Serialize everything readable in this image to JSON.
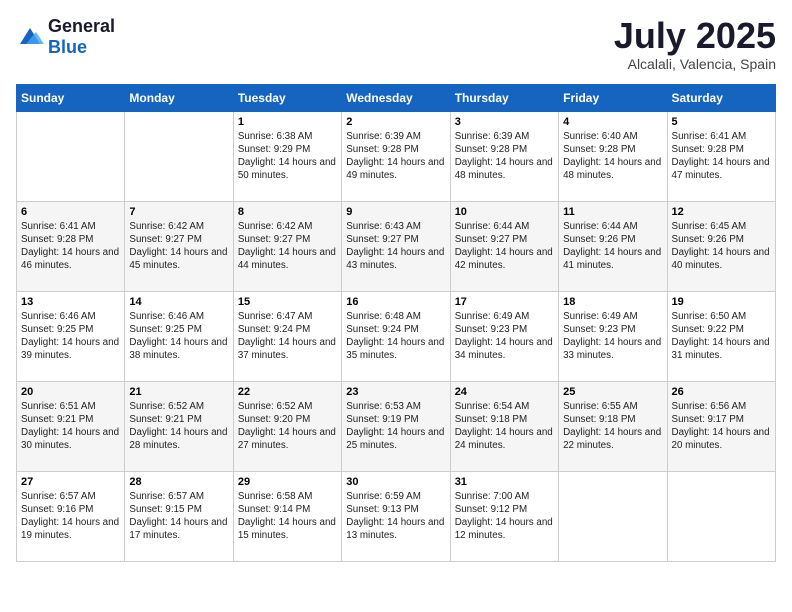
{
  "logo": {
    "general": "General",
    "blue": "Blue"
  },
  "title": "July 2025",
  "location": "Alcalali, Valencia, Spain",
  "days_of_week": [
    "Sunday",
    "Monday",
    "Tuesday",
    "Wednesday",
    "Thursday",
    "Friday",
    "Saturday"
  ],
  "weeks": [
    [
      {
        "day": "",
        "info": ""
      },
      {
        "day": "",
        "info": ""
      },
      {
        "day": "1",
        "info": "Sunrise: 6:38 AM\nSunset: 9:29 PM\nDaylight: 14 hours and 50 minutes."
      },
      {
        "day": "2",
        "info": "Sunrise: 6:39 AM\nSunset: 9:28 PM\nDaylight: 14 hours and 49 minutes."
      },
      {
        "day": "3",
        "info": "Sunrise: 6:39 AM\nSunset: 9:28 PM\nDaylight: 14 hours and 48 minutes."
      },
      {
        "day": "4",
        "info": "Sunrise: 6:40 AM\nSunset: 9:28 PM\nDaylight: 14 hours and 48 minutes."
      },
      {
        "day": "5",
        "info": "Sunrise: 6:41 AM\nSunset: 9:28 PM\nDaylight: 14 hours and 47 minutes."
      }
    ],
    [
      {
        "day": "6",
        "info": "Sunrise: 6:41 AM\nSunset: 9:28 PM\nDaylight: 14 hours and 46 minutes."
      },
      {
        "day": "7",
        "info": "Sunrise: 6:42 AM\nSunset: 9:27 PM\nDaylight: 14 hours and 45 minutes."
      },
      {
        "day": "8",
        "info": "Sunrise: 6:42 AM\nSunset: 9:27 PM\nDaylight: 14 hours and 44 minutes."
      },
      {
        "day": "9",
        "info": "Sunrise: 6:43 AM\nSunset: 9:27 PM\nDaylight: 14 hours and 43 minutes."
      },
      {
        "day": "10",
        "info": "Sunrise: 6:44 AM\nSunset: 9:27 PM\nDaylight: 14 hours and 42 minutes."
      },
      {
        "day": "11",
        "info": "Sunrise: 6:44 AM\nSunset: 9:26 PM\nDaylight: 14 hours and 41 minutes."
      },
      {
        "day": "12",
        "info": "Sunrise: 6:45 AM\nSunset: 9:26 PM\nDaylight: 14 hours and 40 minutes."
      }
    ],
    [
      {
        "day": "13",
        "info": "Sunrise: 6:46 AM\nSunset: 9:25 PM\nDaylight: 14 hours and 39 minutes."
      },
      {
        "day": "14",
        "info": "Sunrise: 6:46 AM\nSunset: 9:25 PM\nDaylight: 14 hours and 38 minutes."
      },
      {
        "day": "15",
        "info": "Sunrise: 6:47 AM\nSunset: 9:24 PM\nDaylight: 14 hours and 37 minutes."
      },
      {
        "day": "16",
        "info": "Sunrise: 6:48 AM\nSunset: 9:24 PM\nDaylight: 14 hours and 35 minutes."
      },
      {
        "day": "17",
        "info": "Sunrise: 6:49 AM\nSunset: 9:23 PM\nDaylight: 14 hours and 34 minutes."
      },
      {
        "day": "18",
        "info": "Sunrise: 6:49 AM\nSunset: 9:23 PM\nDaylight: 14 hours and 33 minutes."
      },
      {
        "day": "19",
        "info": "Sunrise: 6:50 AM\nSunset: 9:22 PM\nDaylight: 14 hours and 31 minutes."
      }
    ],
    [
      {
        "day": "20",
        "info": "Sunrise: 6:51 AM\nSunset: 9:21 PM\nDaylight: 14 hours and 30 minutes."
      },
      {
        "day": "21",
        "info": "Sunrise: 6:52 AM\nSunset: 9:21 PM\nDaylight: 14 hours and 28 minutes."
      },
      {
        "day": "22",
        "info": "Sunrise: 6:52 AM\nSunset: 9:20 PM\nDaylight: 14 hours and 27 minutes."
      },
      {
        "day": "23",
        "info": "Sunrise: 6:53 AM\nSunset: 9:19 PM\nDaylight: 14 hours and 25 minutes."
      },
      {
        "day": "24",
        "info": "Sunrise: 6:54 AM\nSunset: 9:18 PM\nDaylight: 14 hours and 24 minutes."
      },
      {
        "day": "25",
        "info": "Sunrise: 6:55 AM\nSunset: 9:18 PM\nDaylight: 14 hours and 22 minutes."
      },
      {
        "day": "26",
        "info": "Sunrise: 6:56 AM\nSunset: 9:17 PM\nDaylight: 14 hours and 20 minutes."
      }
    ],
    [
      {
        "day": "27",
        "info": "Sunrise: 6:57 AM\nSunset: 9:16 PM\nDaylight: 14 hours and 19 minutes."
      },
      {
        "day": "28",
        "info": "Sunrise: 6:57 AM\nSunset: 9:15 PM\nDaylight: 14 hours and 17 minutes."
      },
      {
        "day": "29",
        "info": "Sunrise: 6:58 AM\nSunset: 9:14 PM\nDaylight: 14 hours and 15 minutes."
      },
      {
        "day": "30",
        "info": "Sunrise: 6:59 AM\nSunset: 9:13 PM\nDaylight: 14 hours and 13 minutes."
      },
      {
        "day": "31",
        "info": "Sunrise: 7:00 AM\nSunset: 9:12 PM\nDaylight: 14 hours and 12 minutes."
      },
      {
        "day": "",
        "info": ""
      },
      {
        "day": "",
        "info": ""
      }
    ]
  ]
}
